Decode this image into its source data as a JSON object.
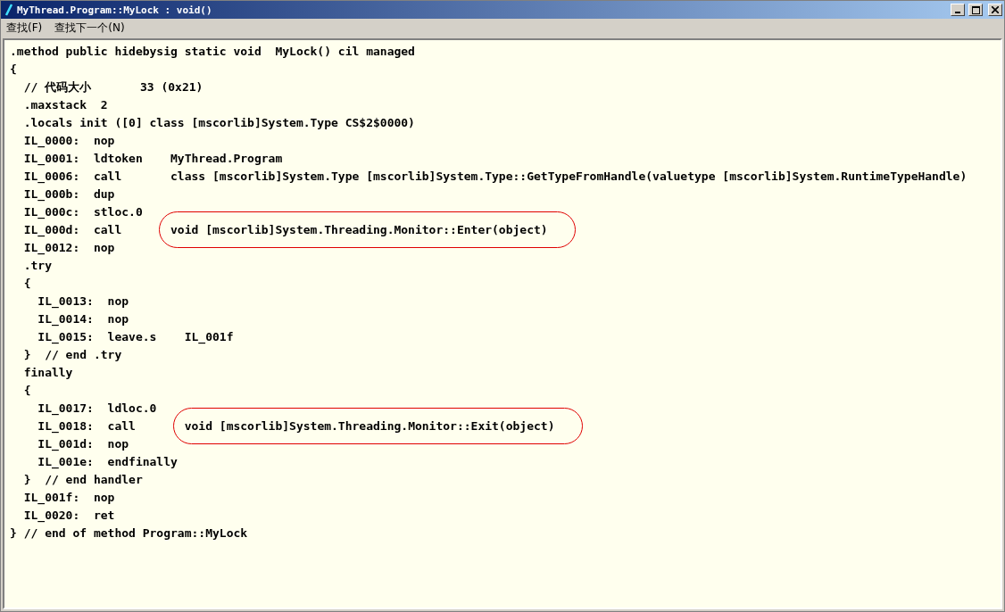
{
  "window": {
    "title": "MyThread.Program::MyLock : void()"
  },
  "menu": [
    {
      "label": "查找(F)"
    },
    {
      "label": "查找下一个(N)"
    }
  ],
  "lines": [
    {
      "code": ".method public hidebysig static void  MyLock() cil managed"
    },
    {
      "code": "{"
    },
    {
      "code": "  // 代码大小       33 (0x21)"
    },
    {
      "code": "  .maxstack  2"
    },
    {
      "code": "  .locals init ([0] class [mscorlib]System.Type CS$2$0000)"
    },
    {
      "code": "  IL_0000:  nop"
    },
    {
      "code": "  IL_0001:  ldtoken    MyThread.Program"
    },
    {
      "code": "  IL_0006:  call       class [mscorlib]System.Type [mscorlib]System.Type::GetTypeFromHandle(valuetype [mscorlib]System.RuntimeTypeHandle)"
    },
    {
      "code": "  IL_000b:  dup"
    },
    {
      "code": "  IL_000c:  stloc.0"
    },
    {
      "code": "  IL_000d:  call       ",
      "operand": "void [mscorlib]System.Threading.Monitor::Enter(object)",
      "circled": true
    },
    {
      "code": "  IL_0012:  nop"
    },
    {
      "code": "  .try"
    },
    {
      "code": "  {"
    },
    {
      "code": "    IL_0013:  nop"
    },
    {
      "code": "    IL_0014:  nop"
    },
    {
      "code": "    IL_0015:  leave.s    IL_001f"
    },
    {
      "code": "  }  // end .try"
    },
    {
      "code": "  finally"
    },
    {
      "code": "  {"
    },
    {
      "code": "    IL_0017:  ldloc.0"
    },
    {
      "code": "    IL_0018:  call       ",
      "operand": "void [mscorlib]System.Threading.Monitor::Exit(object)",
      "circled": true
    },
    {
      "code": "    IL_001d:  nop"
    },
    {
      "code": "    IL_001e:  endfinally"
    },
    {
      "code": "  }  // end handler"
    },
    {
      "code": "  IL_001f:  nop"
    },
    {
      "code": "  IL_0020:  ret"
    },
    {
      "code": "} // end of method Program::MyLock"
    }
  ]
}
